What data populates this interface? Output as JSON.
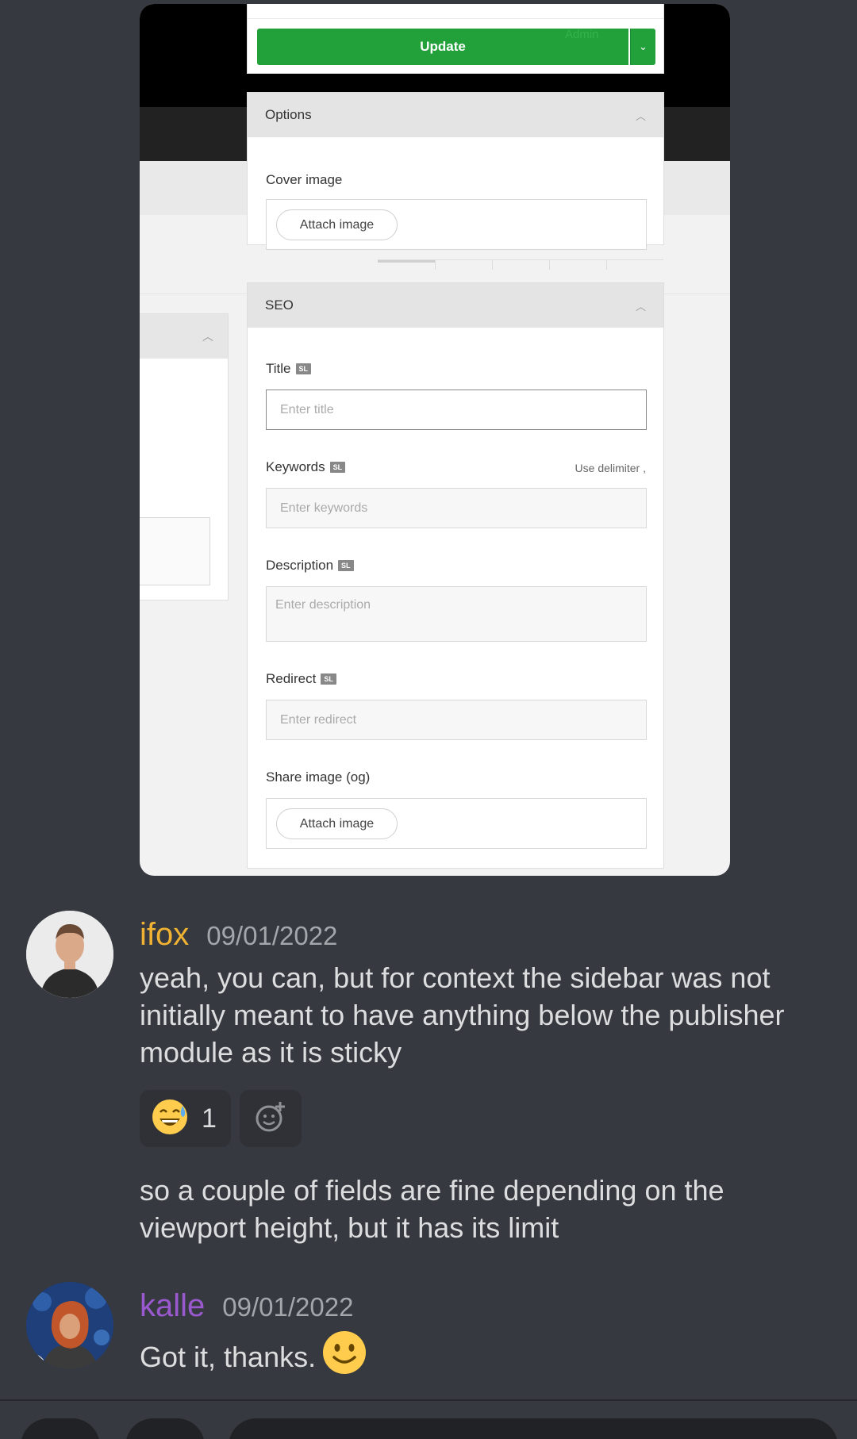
{
  "screenshot": {
    "update_button": "Update",
    "admin_ghost_label": "Admin",
    "options_card": {
      "title": "Options",
      "cover_image_label": "Cover image",
      "attach_button": "Attach image"
    },
    "seo_card": {
      "title": "SEO",
      "badge": "SL",
      "title_label": "Title",
      "title_placeholder": "Enter title",
      "keywords_label": "Keywords",
      "keywords_hint": "Use delimiter ,",
      "keywords_placeholder": "Enter keywords",
      "description_label": "Description",
      "description_placeholder": "Enter description",
      "redirect_label": "Redirect",
      "redirect_placeholder": "Enter redirect",
      "share_image_label": "Share image (og)",
      "attach_button": "Attach image"
    }
  },
  "messages": [
    {
      "username": "ifox",
      "username_color": "#f0b232",
      "timestamp": "09/01/2022",
      "text": "yeah, you can, but for context the sidebar was not initially meant to have anything below the publisher module as it is sticky",
      "reaction": {
        "emoji": "grinning-sweat-emoji",
        "count": "1"
      },
      "followup": "so a couple of fields are fine depending on the viewport height, but it has its limit"
    },
    {
      "username": "kalle",
      "username_color": "#9b59d0",
      "timestamp": "09/01/2022",
      "text": "Got it, thanks.",
      "emoji": "slightly-smiling-emoji"
    }
  ],
  "colors": {
    "background": "#36393f",
    "update_green": "#22a03a",
    "reaction_bg": "#2f3136"
  }
}
